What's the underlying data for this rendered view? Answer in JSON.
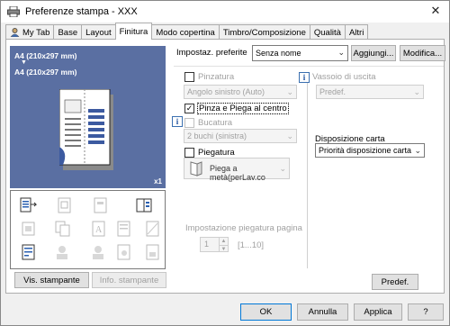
{
  "window": {
    "title": "Preferenze stampa - XXX",
    "close_glyph": "✕"
  },
  "tabs": [
    {
      "label": "My Tab"
    },
    {
      "label": "Base"
    },
    {
      "label": "Layout"
    },
    {
      "label": "Finitura"
    },
    {
      "label": "Modo copertina"
    },
    {
      "label": "Timbro/Composizione"
    },
    {
      "label": "Qualità"
    },
    {
      "label": "Altri"
    }
  ],
  "preview": {
    "size_top": "A4 (210x297 mm)",
    "arrow": "▼",
    "size_bottom": "A4 (210x297 mm)",
    "copies": "x1"
  },
  "left_buttons": {
    "printer_view": "Vis. stampante",
    "printer_info": "Info. stampante"
  },
  "settings": {
    "label": "Impostaz. preferite",
    "value": "Senza nome",
    "add": "Aggiungi...",
    "modify": "Modifica..."
  },
  "finishing": {
    "staple_label": "Pinzatura",
    "staple_value": "Angolo sinistro (Auto)",
    "staple_fold_label": "Pinza e Piega al centro",
    "punch_label": "Bucatura",
    "punch_value": "2 buchi (sinistra)",
    "fold_label": "Piegatura",
    "fold_value": "Piega a metà(perLav.co",
    "fold_setting_label": "Impostazione piegatura pagina",
    "fold_setting_value": "1",
    "fold_setting_range": "[1...10]"
  },
  "tray": {
    "label": "Vassoio di uscita",
    "value": "Predef."
  },
  "paper_arrangement": {
    "label": "Disposizione carta",
    "value": "Priorità disposizione carta"
  },
  "defaults_button": "Predef.",
  "bottom": {
    "ok": "OK",
    "cancel": "Annulla",
    "apply": "Applica",
    "help": "?"
  },
  "icons": {
    "info": "i",
    "checked": "✓"
  }
}
